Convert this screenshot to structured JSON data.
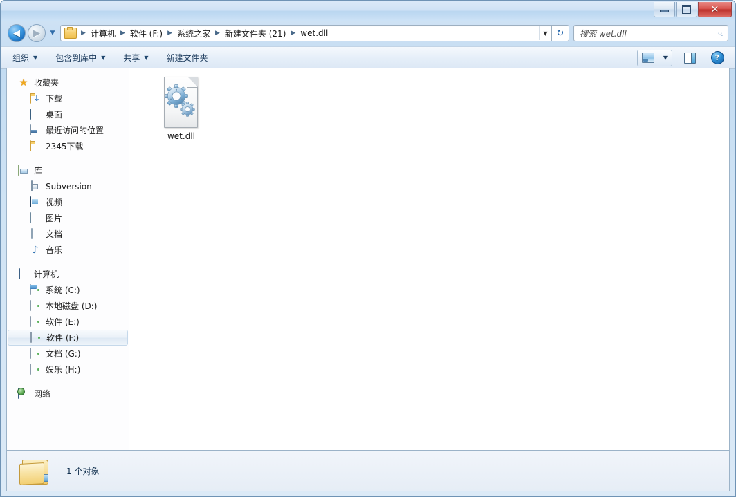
{
  "window": {
    "title": "",
    "controls": {
      "minimize": "—",
      "maximize": "▫",
      "close": "✕"
    }
  },
  "address_bar": {
    "back_glyph": "◀",
    "forward_glyph": "▶",
    "history_caret": "▼",
    "crumbs": [
      "计算机",
      "软件 (F:)",
      "系统之家",
      "新建文件夹 (21)",
      "wet.dll"
    ],
    "separator": "▶",
    "dropdown_caret": "▼",
    "refresh_glyph": "↻"
  },
  "search": {
    "placeholder": "搜索 wet.dll",
    "icon": "search-icon",
    "icon_glyph": "⌕"
  },
  "toolbar": {
    "items": [
      {
        "label": "组织",
        "has_caret": true
      },
      {
        "label": "包含到库中",
        "has_caret": true
      },
      {
        "label": "共享",
        "has_caret": true
      },
      {
        "label": "新建文件夹",
        "has_caret": false
      }
    ],
    "caret": "▼",
    "right": {
      "views_label": "更改您的视图",
      "preview_label": "显示预览窗格",
      "help_label": "?"
    }
  },
  "sidebar": {
    "groups": [
      {
        "header": {
          "label": "收藏夹",
          "icon": "star-icon"
        },
        "items": [
          {
            "label": "下载",
            "icon": "downloads-folder-icon"
          },
          {
            "label": "桌面",
            "icon": "desktop-icon"
          },
          {
            "label": "最近访问的位置",
            "icon": "recent-places-icon"
          },
          {
            "label": "2345下载",
            "icon": "folder-icon"
          }
        ]
      },
      {
        "header": {
          "label": "库",
          "icon": "library-icon"
        },
        "items": [
          {
            "label": "Subversion",
            "icon": "subversion-icon"
          },
          {
            "label": "视频",
            "icon": "video-icon"
          },
          {
            "label": "图片",
            "icon": "pictures-icon"
          },
          {
            "label": "文档",
            "icon": "documents-icon"
          },
          {
            "label": "音乐",
            "icon": "music-icon"
          }
        ]
      },
      {
        "header": {
          "label": "计算机",
          "icon": "computer-icon"
        },
        "items": [
          {
            "label": "系统 (C:)",
            "icon": "system-drive-icon",
            "selected": false
          },
          {
            "label": "本地磁盘 (D:)",
            "icon": "drive-icon",
            "selected": false
          },
          {
            "label": "软件 (E:)",
            "icon": "drive-icon",
            "selected": false
          },
          {
            "label": "软件 (F:)",
            "icon": "drive-icon",
            "selected": true
          },
          {
            "label": "文档 (G:)",
            "icon": "drive-icon",
            "selected": false
          },
          {
            "label": "娱乐 (H:)",
            "icon": "drive-icon",
            "selected": false
          }
        ]
      },
      {
        "header": {
          "label": "网络",
          "icon": "network-icon"
        },
        "items": []
      }
    ]
  },
  "content": {
    "files": [
      {
        "name": "wet.dll",
        "icon": "dll-gears-file-icon",
        "selected": false
      }
    ]
  },
  "status_bar": {
    "icon": "folder-icon",
    "text": "1 个对象"
  },
  "colors": {
    "window_frame": "#c3dcf2",
    "accent_blue": "#2f6ca8",
    "close_red": "#bb2f2a",
    "selection_border": "#c5d8ea",
    "folder_yellow": "#f2c355"
  }
}
